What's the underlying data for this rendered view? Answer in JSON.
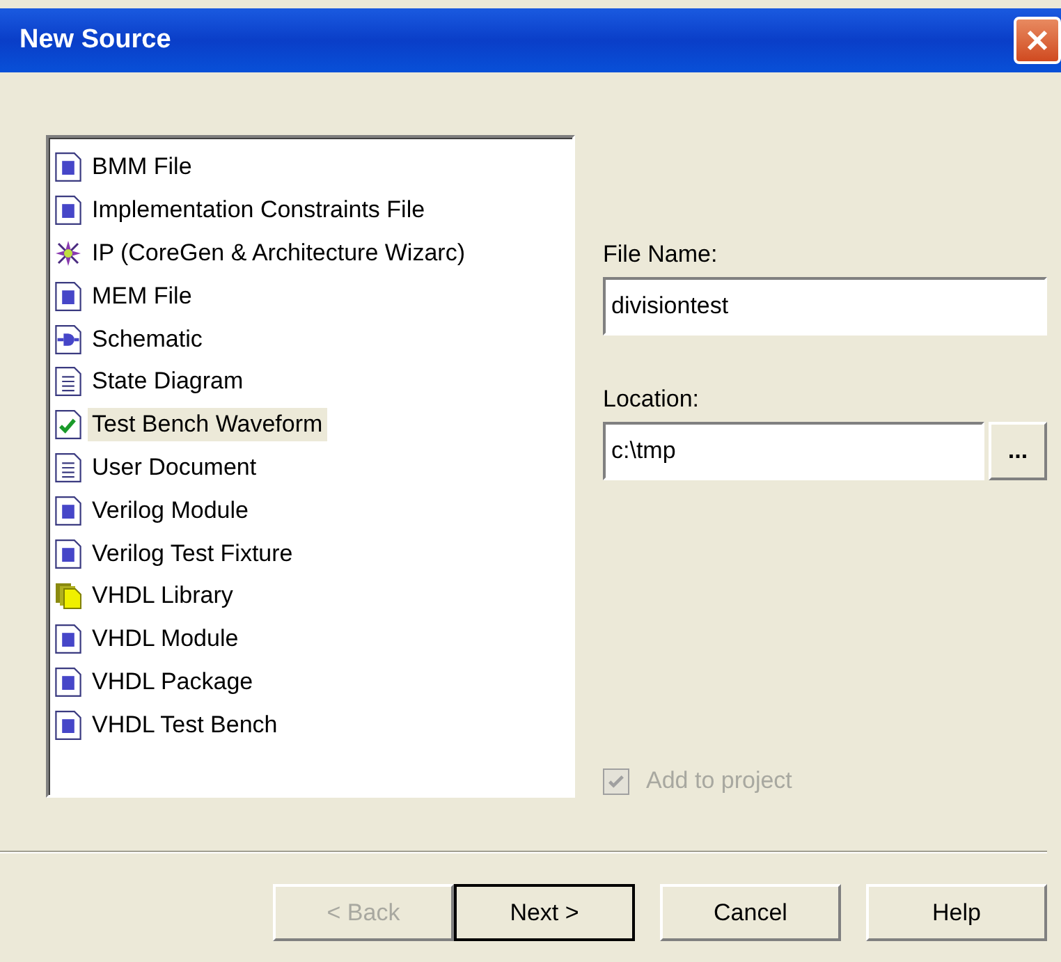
{
  "window": {
    "title": "New Source"
  },
  "source_types": [
    {
      "label": "BMM File",
      "kind": "doc",
      "selected": false
    },
    {
      "label": "Implementation Constraints File",
      "kind": "doc",
      "selected": false
    },
    {
      "label": "IP (CoreGen & Architecture Wizarc)",
      "kind": "ip",
      "selected": false
    },
    {
      "label": "MEM File",
      "kind": "doc",
      "selected": false
    },
    {
      "label": "Schematic",
      "kind": "schematic",
      "selected": false
    },
    {
      "label": "State Diagram",
      "kind": "lines",
      "selected": false
    },
    {
      "label": "Test Bench Waveform",
      "kind": "check",
      "selected": true
    },
    {
      "label": "User Document",
      "kind": "lines",
      "selected": false
    },
    {
      "label": "Verilog Module",
      "kind": "doc",
      "selected": false
    },
    {
      "label": "Verilog Test Fixture",
      "kind": "doc",
      "selected": false
    },
    {
      "label": "VHDL Library",
      "kind": "library",
      "selected": false
    },
    {
      "label": "VHDL Module",
      "kind": "doc",
      "selected": false
    },
    {
      "label": "VHDL Package",
      "kind": "doc",
      "selected": false
    },
    {
      "label": "VHDL Test Bench",
      "kind": "doc",
      "selected": false
    }
  ],
  "file_name": {
    "label": "File Name:",
    "value": "divisiontest"
  },
  "location": {
    "label": "Location:",
    "value": "c:\\tmp",
    "browse": "..."
  },
  "add_to_project": {
    "label": "Add to project",
    "checked": true,
    "disabled": true
  },
  "buttons": [
    {
      "label": "< Back",
      "disabled": true,
      "default": false
    },
    {
      "label": "Next >",
      "disabled": false,
      "default": true
    },
    {
      "label": "Cancel",
      "disabled": false,
      "default": false
    },
    {
      "label": "Help",
      "disabled": false,
      "default": false
    }
  ]
}
